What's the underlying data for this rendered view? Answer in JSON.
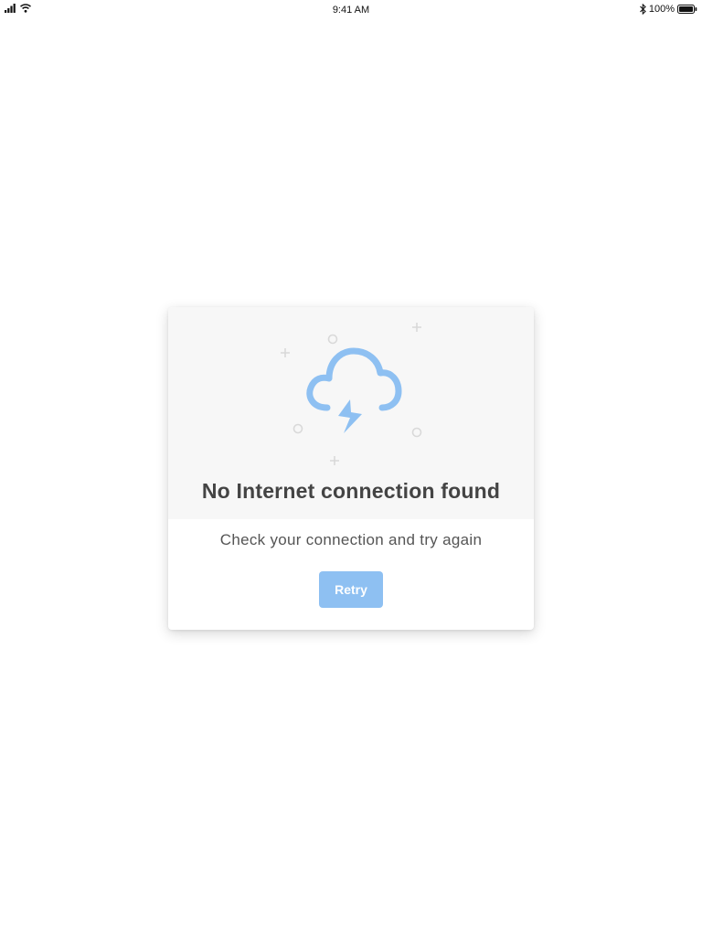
{
  "status_bar": {
    "time": "9:41 AM",
    "battery_percent": "100%",
    "icons": [
      "signal-icon",
      "wifi-icon",
      "bluetooth-icon",
      "battery-icon"
    ]
  },
  "dialog": {
    "illustration_icon": "cloud-lightning-icon",
    "title": "No Internet connection found",
    "message": "Check your connection and try again",
    "retry_label": "Retry"
  },
  "colors": {
    "accent": "#8ec0f2",
    "title_text": "#444444",
    "card_top_bg": "#f7f7f7"
  }
}
